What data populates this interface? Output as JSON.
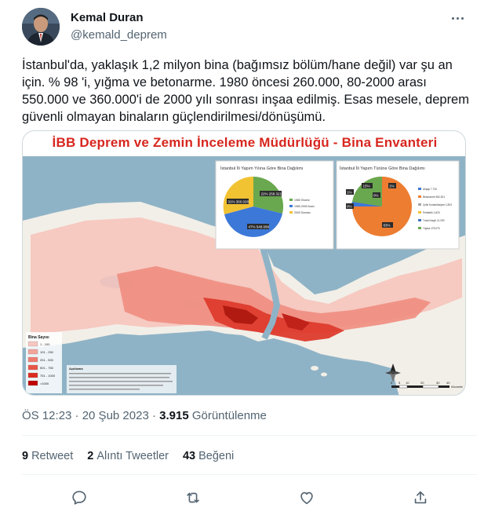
{
  "author": {
    "name": "Kemal Duran",
    "handle": "@kemald_deprem"
  },
  "tweet": {
    "text": "İstanbul'da, yaklaşık 1,2 milyon bina (bağımsız bölüm/hane değil) var şu an için. % 98 'i, yığma ve betonarme. 1980 öncesi 260.000, 80-2000 arası 550.000 ve 360.000'i de 2000 yılı sonrası inşaa edilmiş. Esas mesele, deprem güvenli olmayan binaların güçlendirilmesi/dönüşümü."
  },
  "media": {
    "title": "İBB Deprem ve Zemin İnceleme Müdürlüğü - Bina Envanteri",
    "pie1": {
      "title": "İstanbul İli Yapım Yılına Göre Bina Dağılımı",
      "labels": [
        "22% 258.321",
        "47% 548.099",
        "31% 360.028"
      ],
      "legend": [
        "1980 Öncesi",
        "1980-2000 Arası",
        "2000 Sonrası"
      ],
      "colors": [
        "#6aa84f",
        "#3c78d8",
        "#f1c232"
      ]
    },
    "pie2": {
      "title": "İstanbul İli Yapım Türüne Göre Bina Dağılımı",
      "labels": [
        "1%",
        "15%",
        "0%",
        "0%",
        "1%",
        "83%"
      ],
      "legend": [
        "Ahşap 7.734",
        "Betonarme 962.301",
        "Çelik Konstrüksiyon 1.803",
        "Prefabrik 1.823",
        "Tuvla Kargir 11.290",
        "Yığma 175.070"
      ],
      "colors": [
        "#3c78d8",
        "#ed7d31",
        "#a5a5a5",
        "#f1c232",
        "#4472c4",
        "#6aa84f"
      ]
    },
    "legend_title": "Bina Sayısı",
    "legend_items": [
      "1 - 100",
      "101 - 250",
      "251 - 500",
      "501 - 750",
      "751 - 1000",
      ">1000"
    ],
    "legend_colors": [
      "#f7c6c1",
      "#f4a39a",
      "#ef7b6e",
      "#e85548",
      "#dd2a1e",
      "#c00000"
    ],
    "scale_labels": [
      "0",
      "5",
      "10",
      "20",
      "30",
      "40",
      "Kilometre"
    ],
    "notes_title": "Açıklama"
  },
  "meta": {
    "time": "ÖS 12:23 · 20 Şub 2023 · ",
    "views_count": "3.915",
    "views_label": " Görüntülenme"
  },
  "stats": {
    "retweets_count": "9",
    "retweets_label": "Retweet",
    "quotes_count": "2",
    "quotes_label": "Alıntı Tweetler",
    "likes_count": "43",
    "likes_label": "Beğeni"
  }
}
